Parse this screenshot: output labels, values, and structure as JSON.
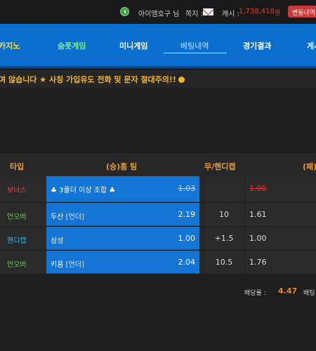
{
  "userbar": {
    "user": "아이엠호구 님",
    "messages_label": "쪽지 :",
    "cash_label": "캐시 :",
    "cash_value": "1,738,418",
    "cash_unit": "원",
    "button_label": "변동내역"
  },
  "nav": {
    "items": [
      {
        "label": "카지노"
      },
      {
        "label": "숨폿게임"
      },
      {
        "label": "미니게임"
      },
      {
        "label": "베팅내역"
      },
      {
        "label": "경기결과"
      },
      {
        "label": "게시판"
      }
    ]
  },
  "ticker": {
    "text": "며 않습니다 ★ 사칭 가입유도 전화 및 문자 절대주의!!"
  },
  "table": {
    "headers": [
      "타입",
      "(승)홈 팀",
      "무/핸디캡",
      "(패)"
    ],
    "rows": [
      {
        "type": "보너스",
        "type_color": "#e05050",
        "home": "♣ 3폴더 이상 조합 ♣",
        "home_tag": "",
        "home_odds": "1.03",
        "handicap": "",
        "away": "1.00",
        "struck": true
      },
      {
        "type": "언오버",
        "type_color": "#6fd04a",
        "home": "두산",
        "home_tag": "[언더]",
        "home_odds": "2.19",
        "handicap": "10",
        "away": "1.61",
        "struck": false
      },
      {
        "type": "핸디캡",
        "type_color": "#35b8e8",
        "home": "삼성",
        "home_tag": "",
        "home_odds": "1.00",
        "handicap": "+1.5",
        "away": "1.00",
        "struck": false
      },
      {
        "type": "언오버",
        "type_color": "#6fd04a",
        "home": "키움",
        "home_tag": "[언더]",
        "home_odds": "2.04",
        "handicap": "10.5",
        "away": "1.76",
        "struck": false
      }
    ]
  },
  "summary": {
    "odds_label": "배당률 :",
    "odds_value": "4.47",
    "bet_label": "배팅"
  }
}
